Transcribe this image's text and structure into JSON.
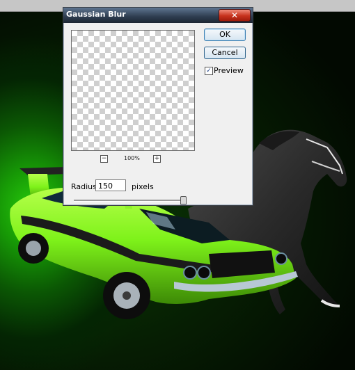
{
  "dialog": {
    "title": "Gaussian Blur",
    "close_symbol": "✕",
    "ok_label": "OK",
    "cancel_label": "Cancel",
    "preview_label": "Preview",
    "preview_checked": true,
    "zoom_out_symbol": "−",
    "zoom_in_symbol": "+",
    "zoom_level": "100%",
    "radius_label": "Radius:",
    "radius_value": "150",
    "pixels_label": "pixels",
    "slider_position": 0.97
  },
  "colors": {
    "background_glow": "#27c80c",
    "car_body": "#7ef21a",
    "title_bar": "#2d3c4f"
  }
}
